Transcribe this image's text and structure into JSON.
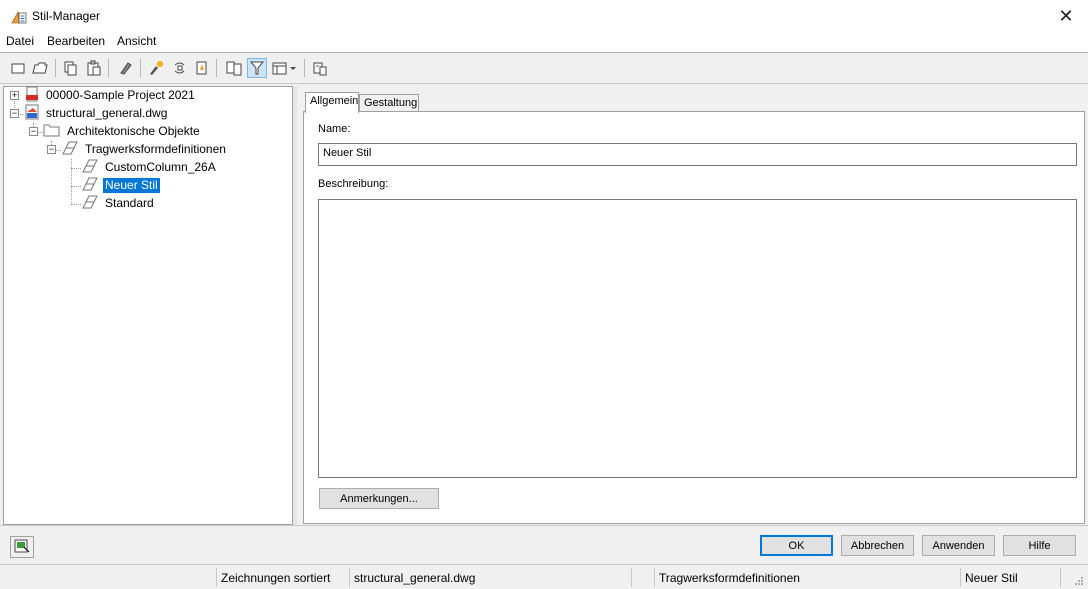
{
  "window": {
    "title": "Stil-Manager",
    "close_glyph": "✕"
  },
  "menu": {
    "items": [
      "Datei",
      "Bearbeiten",
      "Ansicht"
    ]
  },
  "toolbar": {
    "icons": [
      "new-icon",
      "open-icon",
      "copy-icon",
      "paste-icon",
      "purge-icon",
      "edit-icon",
      "sort-icon",
      "update-icon",
      "compare-icon",
      "filter-icon",
      "view-icon",
      "tool-settings-icon"
    ]
  },
  "tree": {
    "nodes": [
      {
        "label": "00000-Sample Project 2021",
        "icon": "project-icon"
      },
      {
        "label": "structural_general.dwg",
        "icon": "dwg-icon"
      },
      {
        "label": "Architektonische Objekte",
        "icon": "folder-icon"
      },
      {
        "label": "Tragwerksformdefinitionen",
        "icon": "member-shape-icon"
      },
      {
        "label": "CustomColumn_26A",
        "icon": "member-shape-icon"
      },
      {
        "label": "Neuer Stil",
        "icon": "member-shape-icon",
        "selected": true
      },
      {
        "label": "Standard",
        "icon": "member-shape-icon"
      }
    ]
  },
  "tabs": {
    "general": "Allgemein",
    "design": "Gestaltung"
  },
  "form": {
    "name_label": "Name:",
    "name_value": "Neuer Stil",
    "description_label": "Beschreibung:",
    "description_value": "",
    "notes_button": "Anmerkungen..."
  },
  "dialog_buttons": {
    "ok": "OK",
    "cancel": "Abbrechen",
    "apply": "Anwenden",
    "help": "Hilfe"
  },
  "statusbar": {
    "sort": "Zeichnungen sortiert",
    "drawing": "structural_general.dwg",
    "category": "Tragwerksformdefinitionen",
    "style": "Neuer Stil"
  },
  "colors": {
    "selection": "#0078d7",
    "window_bg": "#f0f0f0"
  }
}
